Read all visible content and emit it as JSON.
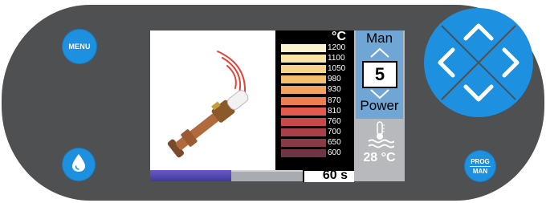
{
  "device": {
    "menu_label": "MENU",
    "prog_label": "PROG",
    "man_label": "MAN",
    "icons": {
      "water": "water-drop-icon",
      "up": "chevron-up-icon",
      "down": "chevron-down-icon",
      "left": "chevron-left-icon",
      "right": "chevron-right-icon"
    },
    "accent_color": "#1e90e0",
    "panel_color": "#4f5052"
  },
  "display": {
    "temperature_unit": "°C",
    "temperature_scale": [
      {
        "label": "1200",
        "color": "#fbf3cf"
      },
      {
        "label": "1100",
        "color": "#f9e4a6"
      },
      {
        "label": "1050",
        "color": "#f8d48a"
      },
      {
        "label": "980",
        "color": "#f6bf6e"
      },
      {
        "label": "930",
        "color": "#f3a35d"
      },
      {
        "label": "870",
        "color": "#ee7e52"
      },
      {
        "label": "810",
        "color": "#e35a4f"
      },
      {
        "label": "760",
        "color": "#c9484c"
      },
      {
        "label": "700",
        "color": "#a84049"
      },
      {
        "label": "650",
        "color": "#8a3a47"
      },
      {
        "label": "600",
        "color": "#6e3643"
      }
    ],
    "mode_label": "Man",
    "power_value": "5",
    "power_label": "Power",
    "water_temperature": "28 °C",
    "time_remaining": "60 s",
    "progress_fraction": 0.53
  }
}
